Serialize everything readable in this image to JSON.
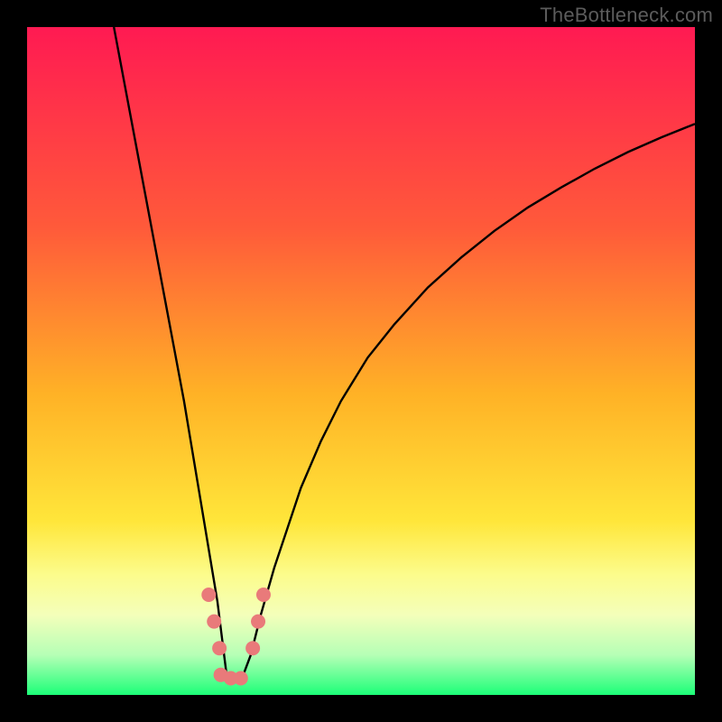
{
  "watermark": "TheBottleneck.com",
  "chart_data": {
    "type": "line",
    "title": "",
    "xlabel": "",
    "ylabel": "",
    "xlim": [
      0,
      100
    ],
    "ylim": [
      0,
      100
    ],
    "background_gradient": {
      "stops": [
        {
          "offset": 0,
          "color": "#ff1a52"
        },
        {
          "offset": 0.3,
          "color": "#ff5a3a"
        },
        {
          "offset": 0.55,
          "color": "#ffb226"
        },
        {
          "offset": 0.74,
          "color": "#ffe63a"
        },
        {
          "offset": 0.82,
          "color": "#fcfc8c"
        },
        {
          "offset": 0.88,
          "color": "#f4ffba"
        },
        {
          "offset": 0.94,
          "color": "#b6ffb6"
        },
        {
          "offset": 1.0,
          "color": "#1cff78"
        }
      ]
    },
    "series": [
      {
        "name": "bottleneck-curve",
        "color": "#000000",
        "x": [
          13.0,
          14.5,
          16.0,
          17.5,
          19.0,
          20.5,
          22.0,
          23.5,
          24.5,
          25.5,
          26.5,
          27.5,
          28.5,
          29.0,
          29.5,
          30.0,
          31.0,
          32.0,
          33.5,
          35.0,
          37.0,
          39.0,
          41.0,
          44.0,
          47.0,
          51.0,
          55.0,
          60.0,
          65.0,
          70.0,
          75.0,
          80.0,
          85.0,
          90.0,
          95.0,
          100.0
        ],
        "y": [
          100.0,
          92.0,
          84.0,
          76.0,
          68.0,
          60.0,
          52.0,
          44.0,
          38.0,
          32.0,
          26.0,
          20.0,
          14.0,
          10.0,
          6.0,
          2.0,
          2.0,
          2.0,
          6.0,
          12.0,
          19.0,
          25.0,
          31.0,
          38.0,
          44.0,
          50.5,
          55.5,
          61.0,
          65.5,
          69.5,
          73.0,
          76.0,
          78.8,
          81.3,
          83.5,
          85.5
        ]
      }
    ],
    "markers": {
      "name": "highlight-points",
      "color": "#e97a7a",
      "radius_px": 8,
      "points": [
        {
          "x": 27.2,
          "y": 15.0
        },
        {
          "x": 28.0,
          "y": 11.0
        },
        {
          "x": 28.8,
          "y": 7.0
        },
        {
          "x": 29.0,
          "y": 3.0
        },
        {
          "x": 30.5,
          "y": 2.5
        },
        {
          "x": 32.0,
          "y": 2.5
        },
        {
          "x": 33.8,
          "y": 7.0
        },
        {
          "x": 34.6,
          "y": 11.0
        },
        {
          "x": 35.4,
          "y": 15.0
        }
      ]
    }
  }
}
